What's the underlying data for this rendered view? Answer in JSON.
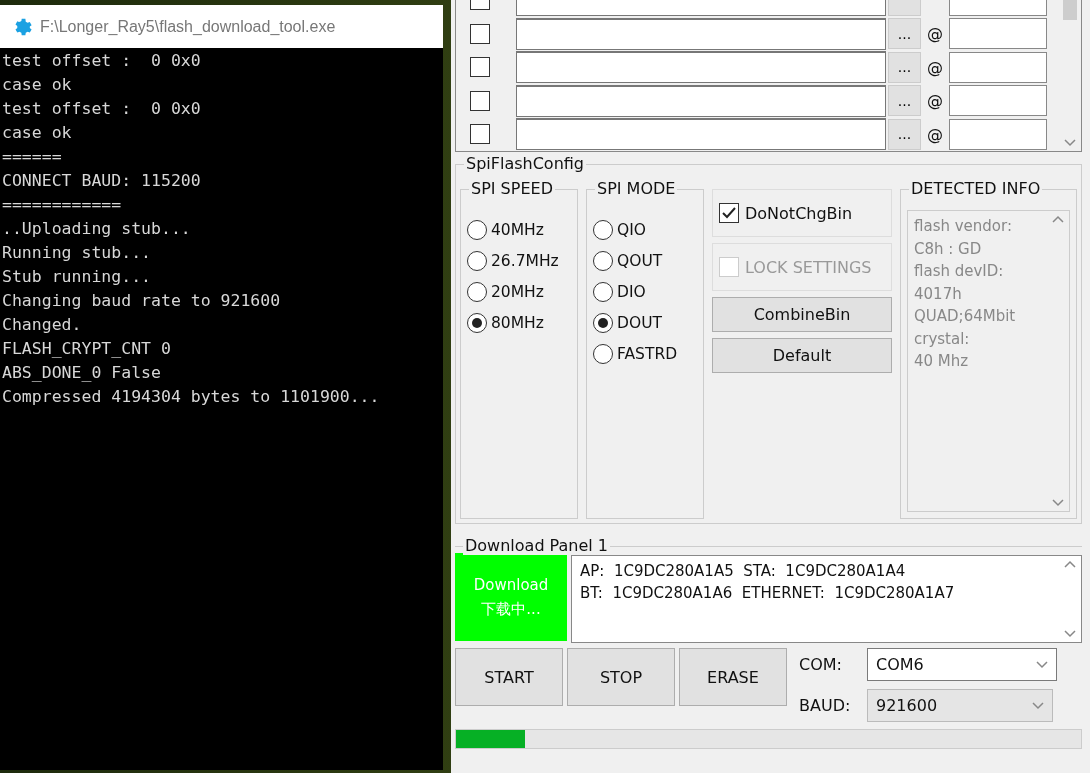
{
  "console_window": {
    "title": "F:\\Longer_Ray5\\flash_download_tool.exe",
    "lines": [
      "test offset :  0 0x0",
      "case ok",
      "test offset :  0 0x0",
      "case ok",
      "======",
      "CONNECT BAUD: 115200",
      "============",
      "..Uploading stub...",
      "Running stub...",
      "Stub running...",
      "Changing baud rate to 921600",
      "Changed.",
      "FLASH_CRYPT_CNT 0",
      "ABS_DONE_0 False",
      "Compressed 4194304 bytes to 1101900..."
    ]
  },
  "file_rows": [
    {
      "checked": false
    },
    {
      "checked": false,
      "browse": "...",
      "at": "@"
    },
    {
      "checked": false,
      "browse": "...",
      "at": "@"
    },
    {
      "checked": false,
      "browse": "...",
      "at": "@"
    },
    {
      "checked": false,
      "browse": "...",
      "at": "@"
    }
  ],
  "spi_flash_config": {
    "title": "SpiFlashConfig",
    "spi_speed": {
      "title": "SPI SPEED",
      "options": [
        {
          "label": "40MHz",
          "selected": false
        },
        {
          "label": "26.7MHz",
          "selected": false
        },
        {
          "label": "20MHz",
          "selected": false
        },
        {
          "label": "80MHz",
          "selected": true
        }
      ]
    },
    "spi_mode": {
      "title": "SPI MODE",
      "options": [
        {
          "label": "QIO",
          "selected": false
        },
        {
          "label": "QOUT",
          "selected": false
        },
        {
          "label": "DIO",
          "selected": false
        },
        {
          "label": "DOUT",
          "selected": true
        },
        {
          "label": "FASTRD",
          "selected": false
        }
      ]
    },
    "do_not_chg_bin": {
      "label": "DoNotChgBin",
      "checked": true
    },
    "lock_settings": {
      "label": "LOCK SETTINGS",
      "checked": false,
      "disabled": true
    },
    "buttons": [
      "CombineBin",
      "Default"
    ],
    "detected_info": {
      "title": "DETECTED INFO",
      "lines": [
        "flash vendor:",
        "C8h : GD",
        "flash devID:",
        "4017h",
        "QUAD;64Mbit",
        "crystal:",
        "40 Mhz"
      ]
    }
  },
  "download_panel": {
    "title": "Download Panel 1",
    "status": [
      "Download",
      "下载中..."
    ],
    "mac_info": [
      "AP:  1C9DC280A1A5  STA:  1C9DC280A1A4",
      "BT:  1C9DC280A1A6  ETHERNET:  1C9DC280A1A7"
    ],
    "buttons": [
      "START",
      "STOP",
      "ERASE"
    ],
    "com": {
      "label": "COM:",
      "value": "COM6"
    },
    "baud": {
      "label": "BAUD:",
      "value": "921600"
    },
    "progress": {
      "level": 0.11
    }
  }
}
